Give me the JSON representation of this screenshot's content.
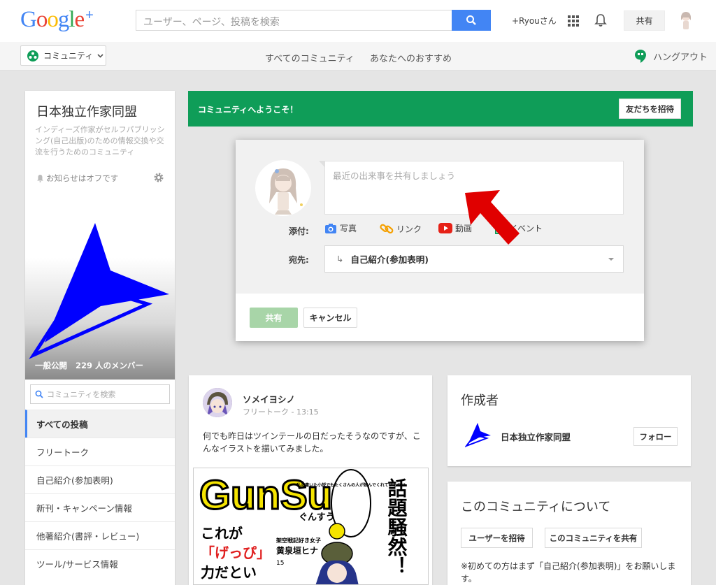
{
  "header": {
    "logo_letters": [
      "G",
      "o",
      "o",
      "g",
      "l",
      "e"
    ],
    "logo_plus": "+",
    "search_placeholder": "ユーザー、ページ、投稿を検索",
    "user_name": "+Ryouさん",
    "share_label": "共有"
  },
  "subnav": {
    "community_dropdown": "コミュニティ",
    "links": [
      "すべてのコミュニティ",
      "あなたへのおすすめ"
    ],
    "hangout": "ハングアウト"
  },
  "community": {
    "title": "日本独立作家同盟",
    "description": "インディーズ作家がセルフパブリッシング(自己出版)のための情報交換や交流を行うためのコミュニティ",
    "notification": "お知らせはオフです",
    "visibility": "一般公開",
    "members": "229 人のメンバー",
    "search_placeholder": "コミュニティを検索",
    "menu": [
      "すべての投稿",
      "フリートーク",
      "自己紹介(参加表明)",
      "新刊・キャンペーン情報",
      "他著紹介(書評・レビュー)",
      "ツール/サービス情報"
    ]
  },
  "welcome": {
    "text": "コミュニティへようこそ！",
    "invite_label": "友だちを招待"
  },
  "compose": {
    "placeholder": "最近の出来事を共有しましょう",
    "attach_label": "添付:",
    "attachments": [
      "写真",
      "リンク",
      "動画",
      "イベント"
    ],
    "dest_label": "宛先:",
    "dest_value": "自己紹介(参加表明)",
    "share_label": "共有",
    "cancel_label": "キャンセル"
  },
  "post": {
    "author": "ソメイヨシノ",
    "category": "フリートーク",
    "time": "13:15",
    "body": "何でも昨日はツインテールの日だったそうなのですが、こんなイラストを描いてみました。",
    "image_text": {
      "brand": "GunSu",
      "brand_kana": "ぐんすう",
      "headline": "話題騒然！",
      "bubble": "私の書いた小説でもたくさんの人が読んでくれているの!?",
      "caption1": "これが",
      "caption2": "「げっぴ」",
      "caption3": "力だとい",
      "author_tag": "架空戦記好き女子",
      "author_name": "黄泉垣ヒナ",
      "author_age": "15"
    }
  },
  "creator": {
    "title": "作成者",
    "name": "日本独立作家同盟",
    "follow_label": "フォロー"
  },
  "about": {
    "title": "このコミュニティについて",
    "buttons": [
      "ユーザーを招待",
      "このコミュニティを共有"
    ],
    "note": "※初めての方はまず「自己紹介(参加表明)」をお願いします。"
  },
  "colors": {
    "accent_blue": "#4285f4",
    "welcome_green": "#0f9d58",
    "community_logo_blue": "#0000ff",
    "arrow_red": "#e00000"
  }
}
